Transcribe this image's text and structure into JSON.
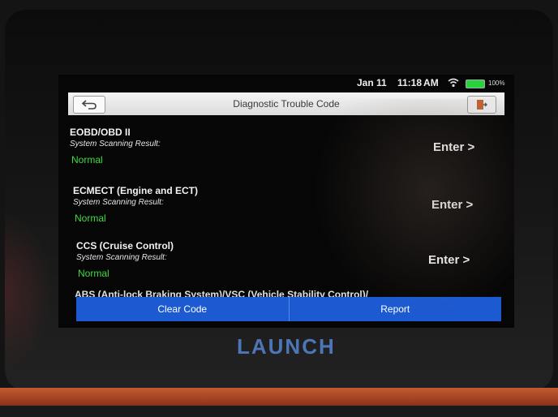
{
  "status_bar": {
    "date": "Jan 11",
    "time": "11:18",
    "ampm": "AM",
    "battery": "100%"
  },
  "title_bar": {
    "title": "Diagnostic Trouble Code"
  },
  "systems": [
    {
      "name": "EOBD/OBD II",
      "subtitle": "System Scanning Result:",
      "status": "Normal",
      "action": "Enter >"
    },
    {
      "name": "ECMECT (Engine and ECT)",
      "subtitle": "System Scanning Result:",
      "status": "Normal",
      "action": "Enter >"
    },
    {
      "name": "CCS (Cruise Control)",
      "subtitle": "System Scanning Result:",
      "status": "Normal",
      "action": "Enter >"
    }
  ],
  "partial_item": "ABS (Anti-lock Braking System)/VSC (Vehicle Stability Control)/",
  "actions": {
    "clear_code": "Clear Code",
    "report": "Report"
  },
  "brand": "LAUNCH",
  "colors": {
    "status_normal": "#3fdc3f",
    "action_bar": "#1c5ad2",
    "brand": "#4d76b8",
    "battery": "#28d23c"
  },
  "icons": {
    "back": "back-arrow-icon",
    "exit": "exit-door-icon",
    "wifi": "wifi-icon",
    "battery": "battery-icon"
  }
}
